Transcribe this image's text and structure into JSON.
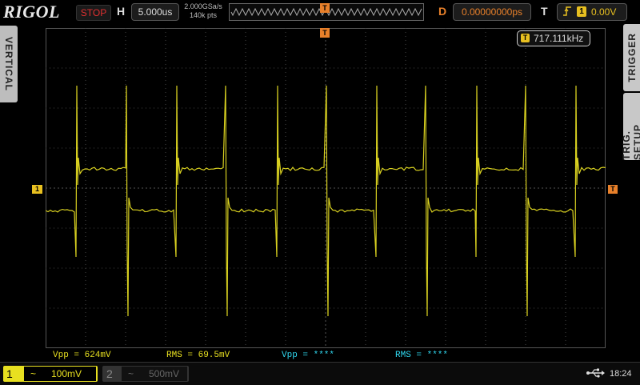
{
  "brand": "RIGOL",
  "run_state": "STOP",
  "horizontal": {
    "label": "H",
    "timebase": "5.000us"
  },
  "acquisition": {
    "sample_rate": "2.000GSa/s",
    "memory_depth": "140k pts"
  },
  "delay": {
    "label": "D",
    "value": "0.00000000ps"
  },
  "trigger": {
    "label": "T",
    "source": "1",
    "level": "0.00V",
    "edge_icon": "rising-edge-icon",
    "marker": "T"
  },
  "side_tabs": {
    "left": "VERTICAL",
    "right_top": "TRIGGER",
    "right_bottom": "TRIG. SETUP"
  },
  "frequency_readout": {
    "badge": "T",
    "value": "717.111kHz"
  },
  "channel_marker": "1",
  "measurements": {
    "ch1_vpp": "Vpp = 624mV",
    "ch1_rms": "RMS = 69.5mV",
    "ch2_vpp": "Vpp = ****",
    "ch2_rms": "RMS = ****"
  },
  "channels": [
    {
      "number": "1",
      "coupling": "~",
      "scale": "100mV",
      "color": "#e8e020",
      "active": true
    },
    {
      "number": "2",
      "coupling": "~",
      "scale": "500mV",
      "color": "#666666",
      "active": false
    }
  ],
  "status": {
    "usb_icon": "usb-icon",
    "time": "18:24"
  },
  "colors": {
    "ch1": "#e8e020",
    "trigger": "#e8802a",
    "ch2_meas": "#30d8f0",
    "stop": "#e03030"
  }
}
